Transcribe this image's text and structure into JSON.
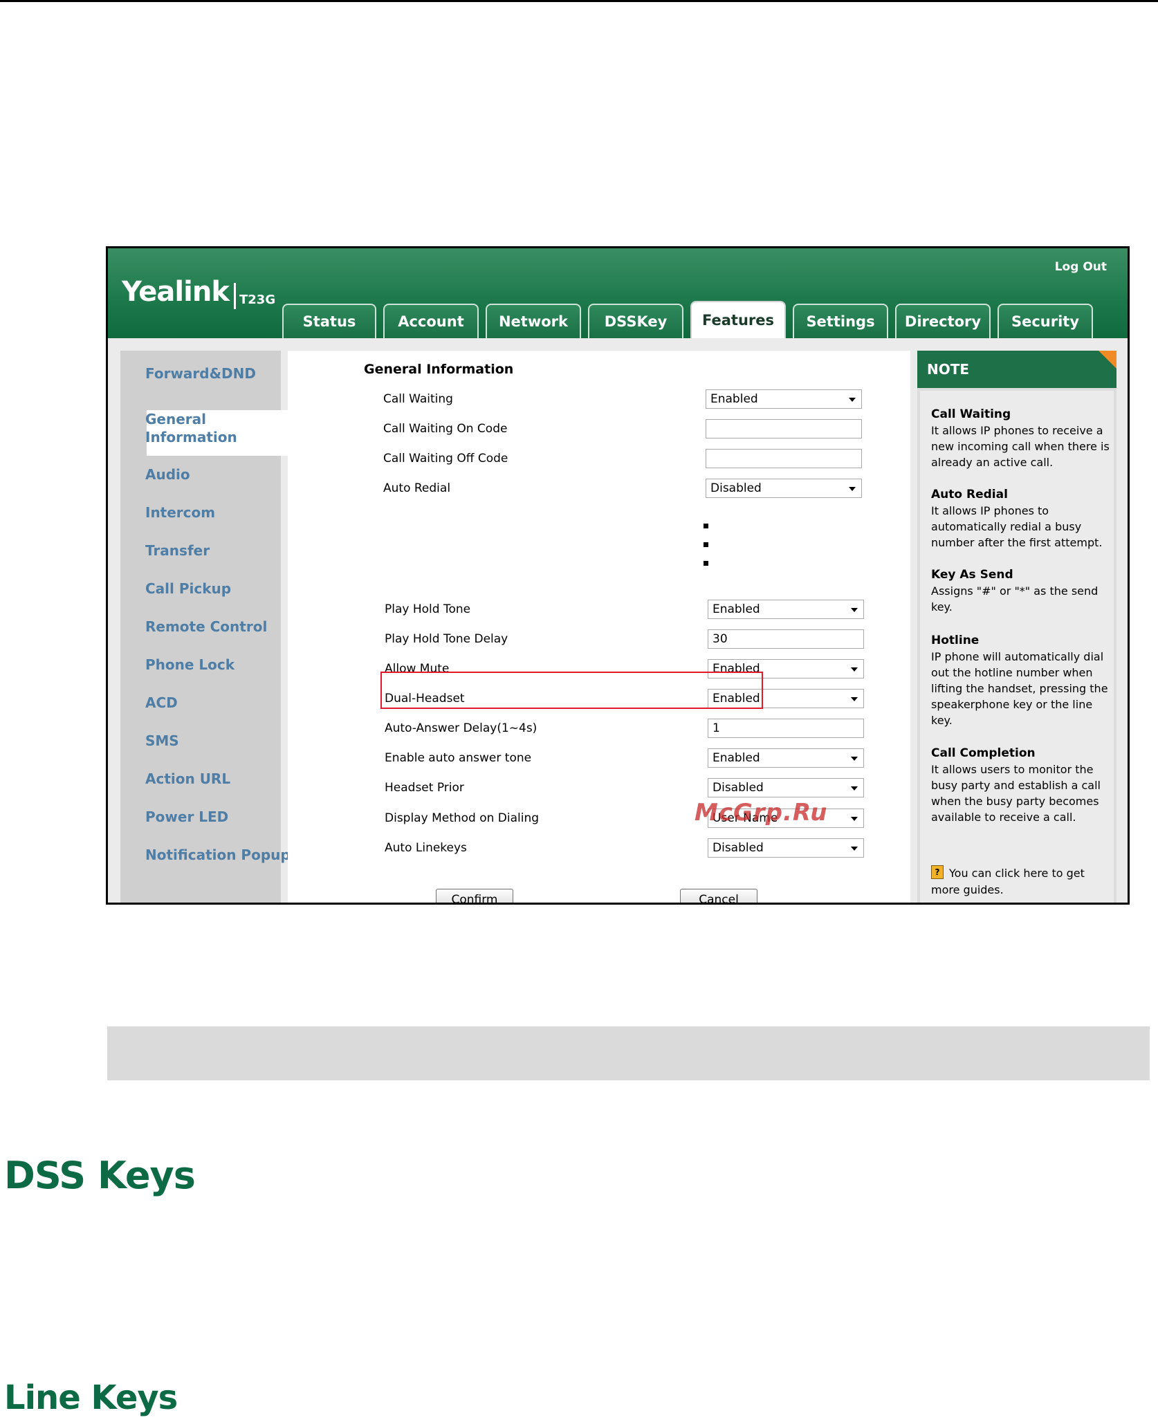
{
  "header": {
    "logo": "Yealink",
    "model": "T23G",
    "logout": "Log Out",
    "tabs": [
      "Status",
      "Account",
      "Network",
      "DSSKey",
      "Features",
      "Settings",
      "Directory",
      "Security"
    ],
    "active_tab": "Features"
  },
  "sidebar": {
    "items": [
      "Forward&DND",
      "General\nInformation",
      "Audio",
      "Intercom",
      "Transfer",
      "Call Pickup",
      "Remote Control",
      "Phone Lock",
      "ACD",
      "SMS",
      "Action URL",
      "Power LED",
      "Notification Popups"
    ],
    "general_1": "General",
    "general_2": "Information"
  },
  "content": {
    "section_title": "General Information",
    "rows_top": [
      {
        "label": "Call Waiting",
        "value": "Enabled",
        "type": "select"
      },
      {
        "label": "Call Waiting On Code",
        "value": "",
        "type": "text"
      },
      {
        "label": "Call Waiting Off Code",
        "value": "",
        "type": "text"
      },
      {
        "label": "Auto Redial",
        "value": "Disabled",
        "type": "select"
      }
    ],
    "rows_bottom": [
      {
        "label": "Play Hold Tone",
        "value": "Enabled",
        "type": "select"
      },
      {
        "label": "Play Hold Tone Delay",
        "value": "30",
        "type": "text"
      },
      {
        "label": "Allow Mute",
        "value": "Enabled",
        "type": "select"
      },
      {
        "label": "Dual-Headset",
        "value": "Enabled",
        "type": "select"
      },
      {
        "label": "Auto-Answer Delay(1~4s)",
        "value": "1",
        "type": "text"
      },
      {
        "label": "Enable auto answer tone",
        "value": "Enabled",
        "type": "select"
      },
      {
        "label": "Headset Prior",
        "value": "Disabled",
        "type": "select"
      },
      {
        "label": "Display Method on Dialing",
        "value": "User Name",
        "type": "select"
      },
      {
        "label": "Auto Linekeys",
        "value": "Disabled",
        "type": "select"
      }
    ],
    "confirm": "Confirm",
    "cancel": "Cancel",
    "watermark": "McGrp.Ru"
  },
  "note": {
    "title": "NOTE",
    "items": [
      {
        "title": "Call Waiting",
        "lines": [
          "It allows IP phones to receive a",
          "new incoming call when there is",
          "already an active call."
        ]
      },
      {
        "title": "Auto Redial",
        "lines": [
          "It allows IP phones to",
          "automatically redial a busy",
          "number after the first attempt."
        ]
      },
      {
        "title": "Key As Send",
        "lines": [
          "Assigns \"#\" or \"*\" as the send",
          "key."
        ]
      },
      {
        "title": "Hotline",
        "lines": [
          "IP phone will automatically dial",
          "out the hotline number when",
          "lifting the handset, pressing the",
          "speakerphone key or the line",
          "key."
        ]
      },
      {
        "title": "Call Completion",
        "lines": [
          "It allows users to monitor the",
          "busy party and establish a call",
          "when the busy party becomes",
          "available to receive a call."
        ]
      }
    ],
    "guide_1": "You can click here to get",
    "guide_2": "more guides."
  },
  "doc": {
    "heading_1": "DSS Keys",
    "heading_2": "Line Keys"
  }
}
